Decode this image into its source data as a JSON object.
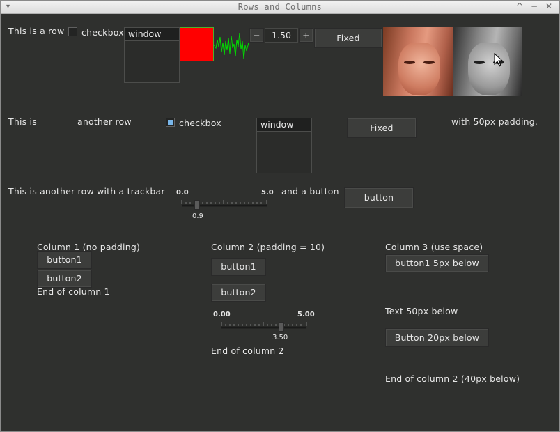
{
  "window": {
    "title": "Rows and Columns",
    "controls": {
      "menu": "▾",
      "maximize": "^",
      "minimize": "−",
      "close": "✕"
    }
  },
  "row1": {
    "label": "This is a row",
    "checkbox_label": "checkbox",
    "checkbox_checked": false,
    "window_title": "window",
    "red_box_color": "#ff0000",
    "counter_minus": "−",
    "counter_value": "1.50",
    "counter_plus": "+",
    "fixed_button": "Fixed"
  },
  "row2": {
    "label_left": "This is",
    "label_mid": "another row",
    "checkbox_label": "checkbox",
    "checkbox_checked": true,
    "window_title": "window",
    "fixed_button": "Fixed",
    "label_right": "with 50px padding."
  },
  "row3": {
    "label": "This is another row with a trackbar",
    "trackbar": {
      "min": "0.0",
      "max": "5.0",
      "value": "0.9",
      "fraction": 0.18
    },
    "label_button": "and a button",
    "button": "button"
  },
  "col1": {
    "title": "Column 1 (no padding)",
    "button1": "button1",
    "button2": "button2",
    "end": "End of column 1"
  },
  "col2": {
    "title": "Column 2 (padding = 10)",
    "button1": "button1",
    "button2": "button2",
    "trackbar": {
      "min": "0.00",
      "max": "5.00",
      "value": "3.50",
      "fraction": 0.7
    },
    "end": "End of column 2"
  },
  "col3": {
    "title": "Column 3 (use space)",
    "button1": "button1 5px below",
    "text": "Text 50px below",
    "button2": "Button 20px below",
    "end": "End of column 2 (40px below)"
  }
}
